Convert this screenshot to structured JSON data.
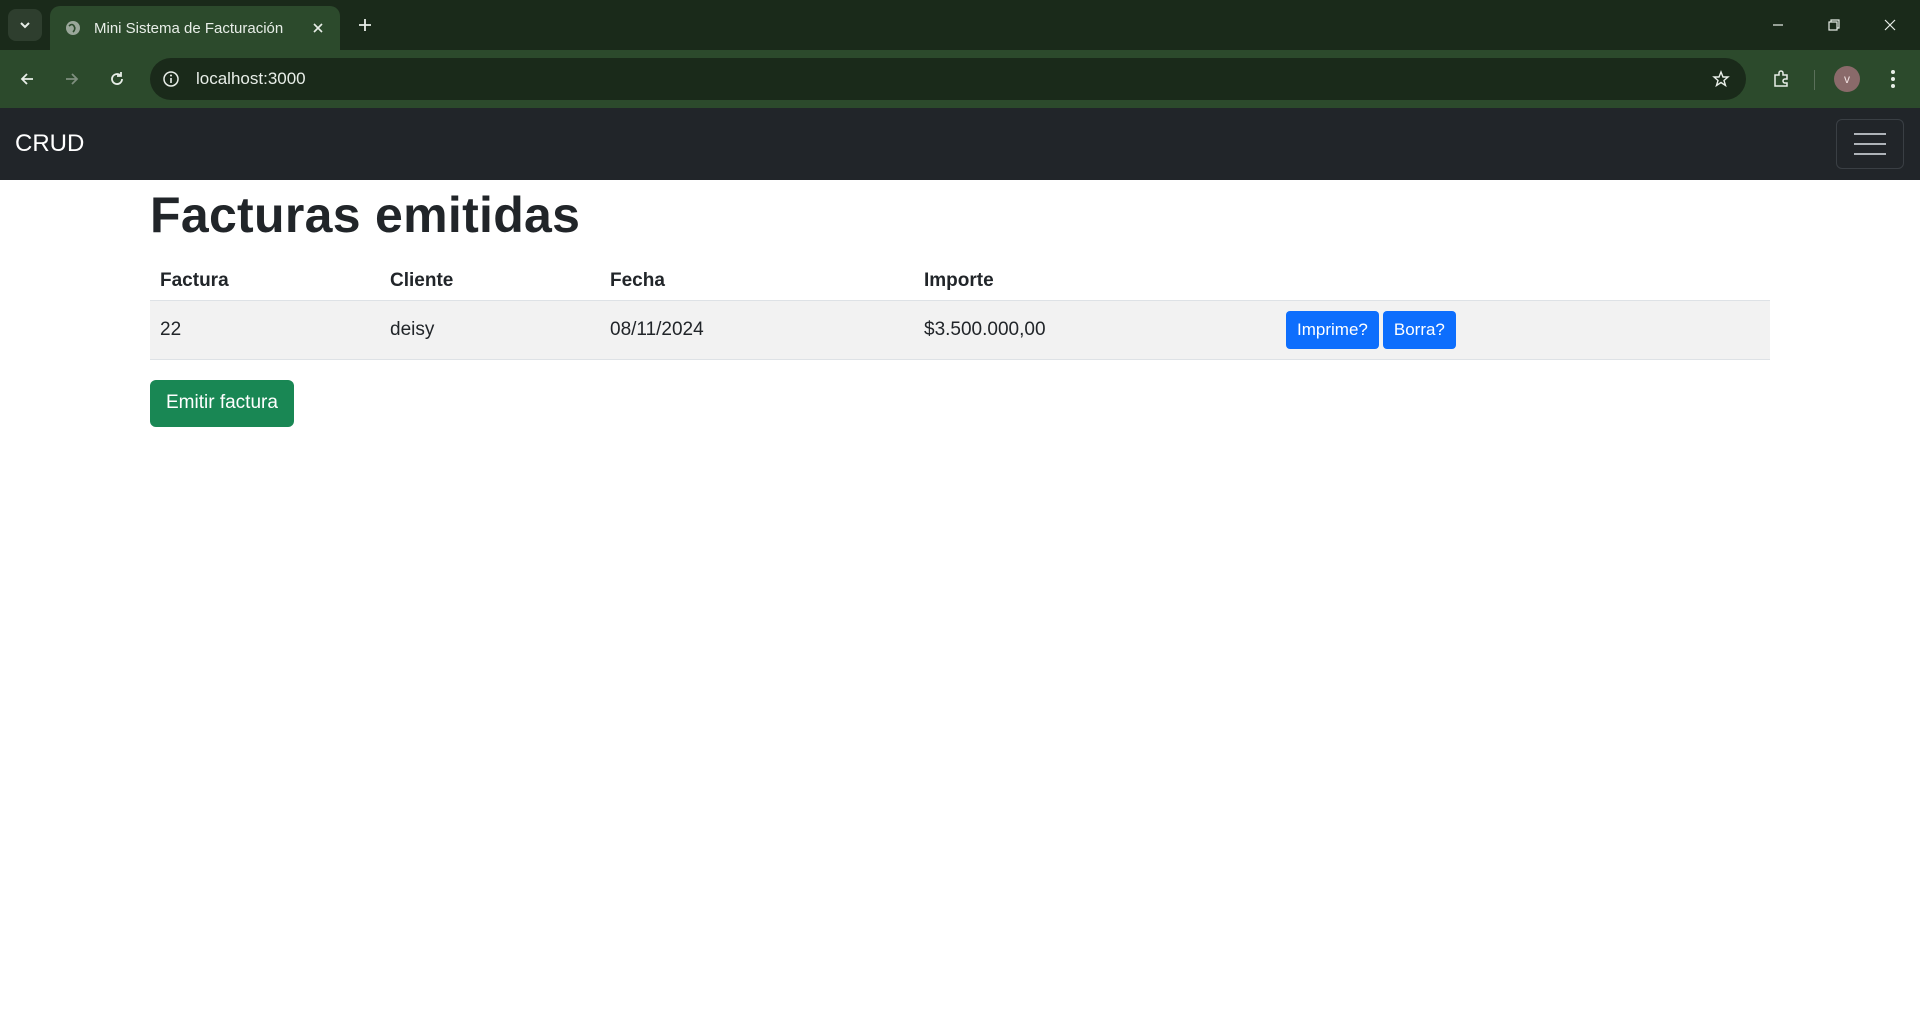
{
  "browser": {
    "tab_title": "Mini Sistema de Facturación",
    "url": "localhost:3000",
    "profile_initial": "v"
  },
  "navbar": {
    "brand": "CRUD"
  },
  "main": {
    "title": "Facturas emitidas",
    "table": {
      "headers": [
        "Factura",
        "Cliente",
        "Fecha",
        "Importe",
        ""
      ],
      "rows": [
        {
          "factura": "22",
          "cliente": "deisy",
          "fecha": "08/11/2024",
          "importe": "$3.500.000,00",
          "print_label": "Imprime?",
          "delete_label": "Borra?"
        }
      ]
    },
    "emit_label": "Emitir factura"
  },
  "colors": {
    "navbar_bg": "#212529",
    "primary": "#0d6efd",
    "success": "#198754",
    "browser_frame": "#2c4a2c"
  }
}
